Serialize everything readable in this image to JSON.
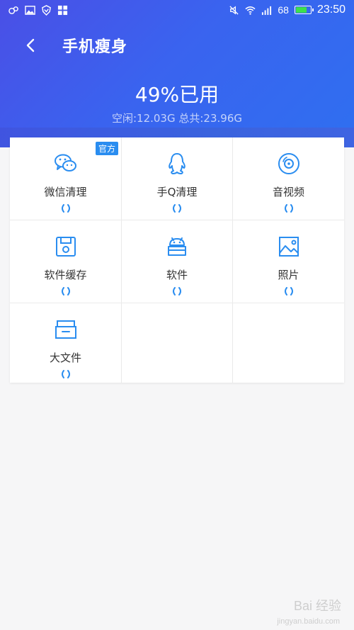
{
  "status_bar": {
    "battery_level": "68",
    "time": "23:50",
    "icons_left": [
      "app-icon",
      "image-icon",
      "shield-icon",
      "grid-icon"
    ],
    "icons_right": [
      "mute-icon",
      "wifi-icon",
      "signal-icon",
      "battery-icon"
    ]
  },
  "header": {
    "title": "手机瘦身",
    "usage": "49%已用",
    "storage": "空闲:12.03G 总共:23.96G"
  },
  "grid": {
    "items": [
      {
        "label": "微信清理",
        "badge": "官方",
        "icon": "wechat-icon"
      },
      {
        "label": "手Q清理",
        "icon": "qq-icon"
      },
      {
        "label": "音视频",
        "icon": "disc-icon"
      },
      {
        "label": "软件缓存",
        "icon": "save-icon"
      },
      {
        "label": "软件",
        "icon": "android-icon"
      },
      {
        "label": "照片",
        "icon": "photo-icon"
      },
      {
        "label": "大文件",
        "icon": "archive-icon"
      }
    ]
  },
  "watermark": {
    "brand": "Bai 经验",
    "url": "jingyan.baidu.com"
  },
  "colors": {
    "accent": "#2a8df0",
    "header_start": "#4a4fe6",
    "header_end": "#2f6ff0"
  }
}
